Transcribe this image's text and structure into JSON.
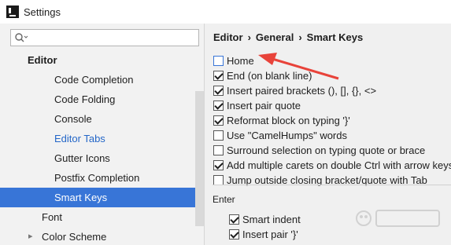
{
  "window": {
    "title": "Settings"
  },
  "search": {
    "placeholder": ""
  },
  "sidebar": {
    "section": "Editor",
    "items": [
      {
        "label": "Code Completion"
      },
      {
        "label": "Code Folding"
      },
      {
        "label": "Console"
      },
      {
        "label": "Editor Tabs",
        "state": "link"
      },
      {
        "label": "Gutter Icons"
      },
      {
        "label": "Postfix Completion"
      },
      {
        "label": "Smart Keys",
        "state": "selected"
      }
    ],
    "font": "Font",
    "color_scheme": "Color Scheme"
  },
  "breadcrumb": [
    "Editor",
    "General",
    "Smart Keys"
  ],
  "breadcrumb_separator": "›",
  "options": [
    {
      "label": "Home",
      "checked": false
    },
    {
      "label": "End (on blank line)",
      "checked": true
    },
    {
      "label": "Insert paired brackets (), [], {}, <>",
      "checked": true
    },
    {
      "label": "Insert pair quote",
      "checked": true
    },
    {
      "label": "Reformat block on typing '}'",
      "checked": true
    },
    {
      "label": "Use \"CamelHumps\" words",
      "checked": false
    },
    {
      "label": "Surround selection on typing quote or brace",
      "checked": false
    },
    {
      "label": "Add multiple carets on double Ctrl with arrow keys",
      "checked": true
    },
    {
      "label": "Jump outside closing bracket/quote with Tab",
      "checked": false
    }
  ],
  "enter_section": {
    "title": "Enter",
    "options": [
      {
        "label": "Smart indent",
        "checked": true
      },
      {
        "label": "Insert pair '}'",
        "checked": true
      }
    ]
  },
  "colors": {
    "selection": "#3875d7",
    "link": "#2567c8",
    "annotation_arrow": "#e8433a"
  }
}
